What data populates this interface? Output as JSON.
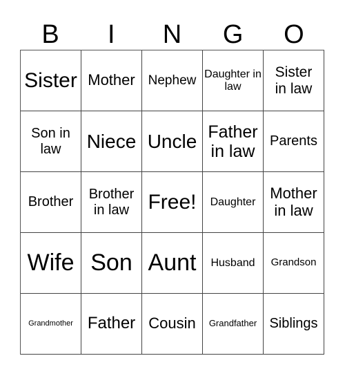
{
  "header": [
    "B",
    "I",
    "N",
    "G",
    "O"
  ],
  "cells": [
    [
      "Sister",
      "Mother",
      "Nephew",
      "Daughter in law",
      "Sister in law"
    ],
    [
      "Son in law",
      "Niece",
      "Uncle",
      "Father in law",
      "Parents"
    ],
    [
      "Brother",
      "Brother in law",
      "Free!",
      "Daughter",
      "Mother in law"
    ],
    [
      "Wife",
      "Son",
      "Aunt",
      "Husband",
      "Grandson"
    ],
    [
      "Grandmother",
      "Father",
      "Cousin",
      "Grandfather",
      "Siblings"
    ]
  ]
}
